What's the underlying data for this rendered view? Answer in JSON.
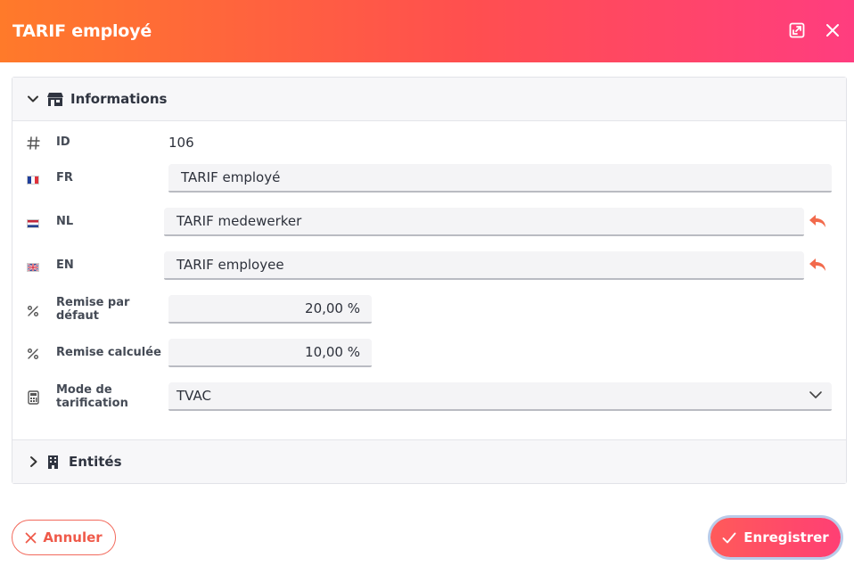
{
  "header": {
    "title": "TARIF employé"
  },
  "section_info": {
    "title": "Informations"
  },
  "section_entities": {
    "title": "Entités"
  },
  "fields": {
    "id": {
      "label": "ID",
      "value": "106"
    },
    "fr": {
      "label": "FR",
      "value": "TARIF employé"
    },
    "nl": {
      "label": "NL",
      "value": "TARIF medewerker"
    },
    "en": {
      "label": "EN",
      "value": "TARIF employee"
    },
    "remise_defaut": {
      "label": "Remise par défaut",
      "value": "20,00 %"
    },
    "remise_calculee": {
      "label": "Remise calculée",
      "value": "10,00 %"
    },
    "mode_tarification": {
      "label": "Mode de tarification",
      "value": "TVAC"
    }
  },
  "buttons": {
    "cancel": "Annuler",
    "save": "Enregistrer"
  },
  "colors": {
    "accent": "#ff4f4f",
    "undo": "#f26a4c",
    "gradient_start": "#ff7a2a",
    "gradient_end": "#ff3d7f"
  },
  "icons": {
    "maximize": "maximize-icon",
    "close": "close-icon",
    "section_info": "store-icon",
    "section_entities": "building-icon",
    "id": "hash-icon",
    "percent": "percent-icon",
    "calculator": "calculator-icon",
    "undo": "undo-arrow-icon"
  }
}
